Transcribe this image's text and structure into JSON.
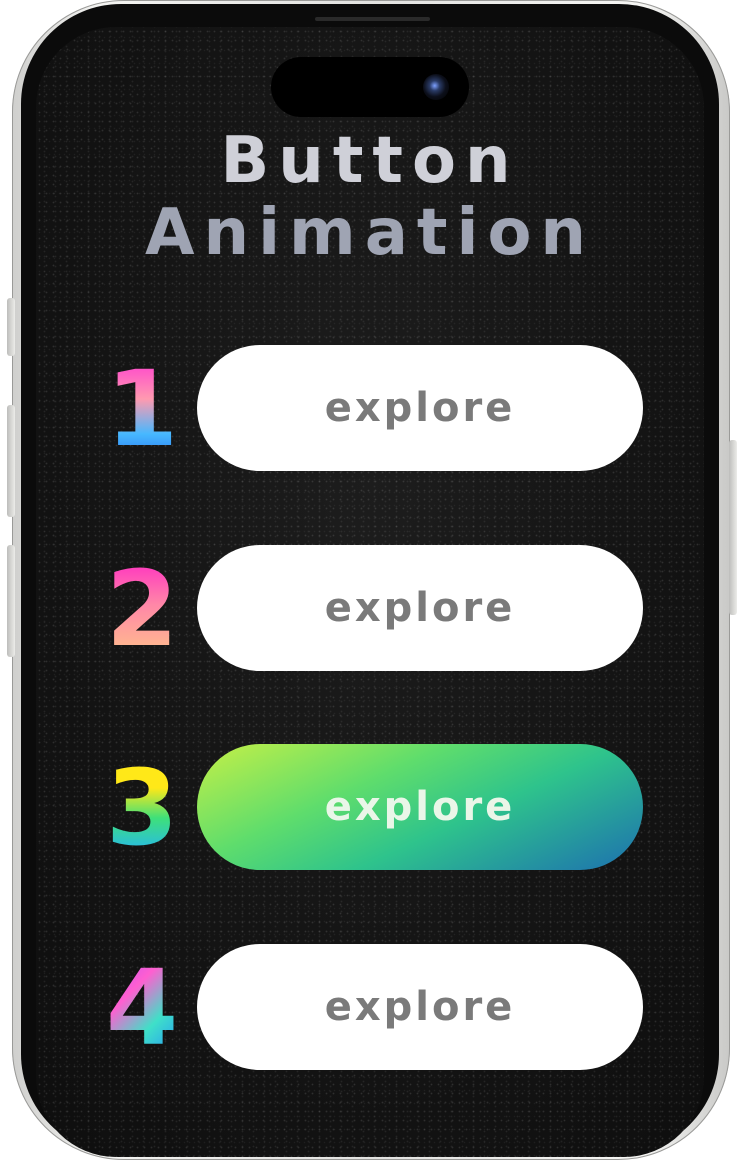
{
  "title": {
    "line1": "Button",
    "line2": "Animation"
  },
  "buttons": [
    {
      "number": "1",
      "label": "explore",
      "state": "default"
    },
    {
      "number": "2",
      "label": "explore",
      "state": "default"
    },
    {
      "number": "3",
      "label": "explore",
      "state": "active-gradient"
    },
    {
      "number": "4",
      "label": "explore",
      "state": "default"
    }
  ],
  "colors": {
    "screen_background": "#141414",
    "button_default_bg": "#ffffff",
    "button_default_text": "#7a7a7a",
    "button_active_gradient": [
      "#c6f046",
      "#5fdd6c",
      "#2ec38c",
      "#1d6fb0"
    ],
    "title_color": "#b4b6c3"
  },
  "icons": {
    "camera": "front-camera-icon"
  }
}
